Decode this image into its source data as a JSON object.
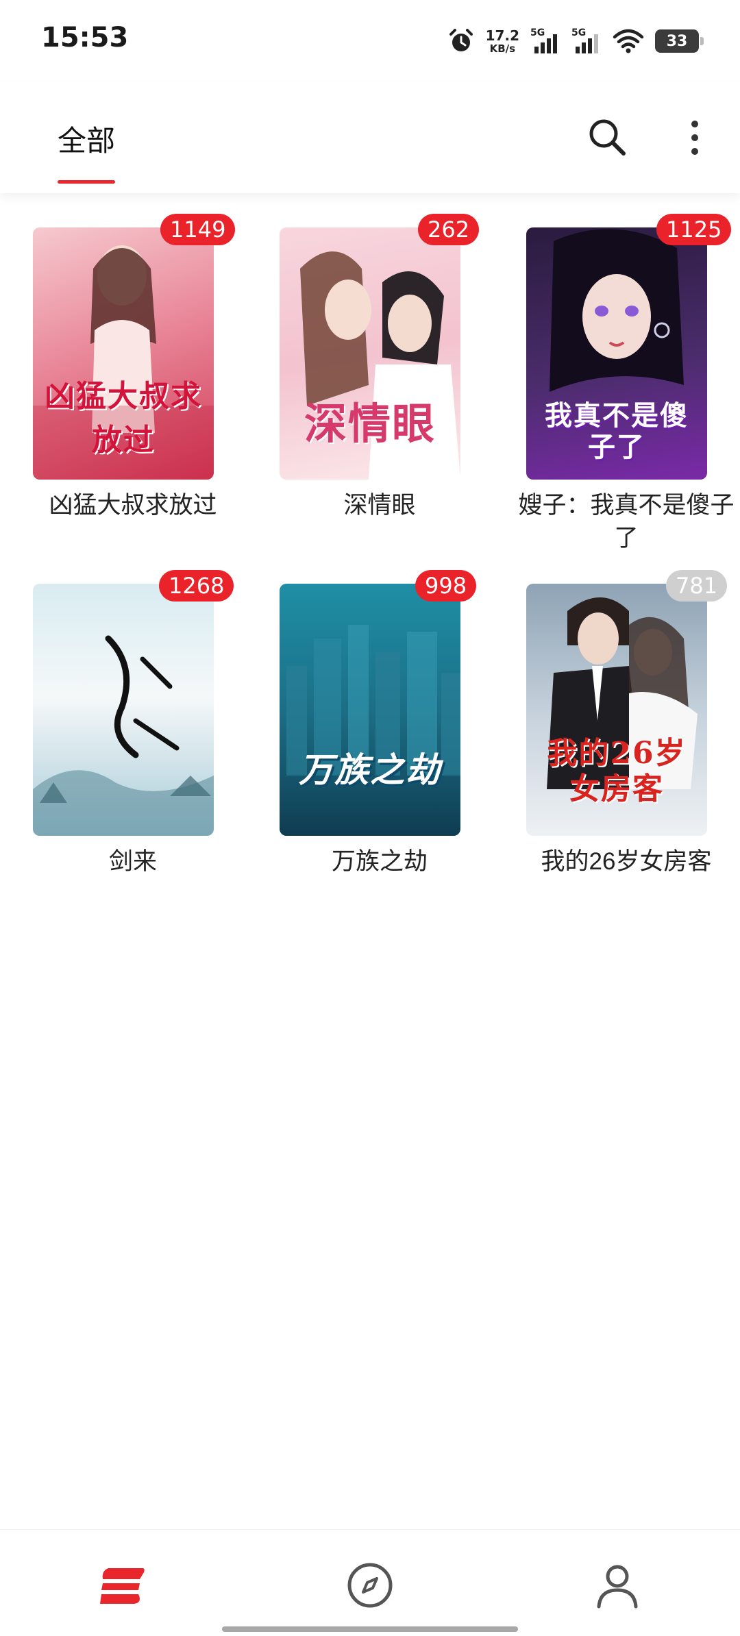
{
  "status_bar": {
    "time": "15:53",
    "net_speed_value": "17.2",
    "net_speed_unit": "KB/s",
    "sim1_tag": "5G",
    "sim2_tag": "5G",
    "battery": "33"
  },
  "header": {
    "tab_label": "全部",
    "search_icon": "search-icon",
    "more_icon": "more-vertical-icon"
  },
  "books": [
    {
      "title": "凶猛大叔求放过",
      "cover_text": "凶猛大叔求放过",
      "badge": "1149",
      "badge_color": "#ea2229"
    },
    {
      "title": "深情眼",
      "cover_text": "深情眼",
      "badge": "262",
      "badge_color": "#ea2229"
    },
    {
      "title": "嫂子：我真不是傻子了",
      "cover_text": "我真不是傻子了",
      "badge": "1125",
      "badge_color": "#ea2229"
    },
    {
      "title": "剑来",
      "cover_text": "剑来",
      "badge": "1268",
      "badge_color": "#ea2229"
    },
    {
      "title": "万族之劫",
      "cover_text": "万族之劫",
      "badge": "998",
      "badge_color": "#ea2229"
    },
    {
      "title": "我的26岁女房客",
      "cover_text": "我的26岁女房客",
      "badge": "781",
      "badge_color": "#cfcfcf"
    }
  ],
  "bottom_nav": {
    "bookshelf_icon": "bookshelf-icon",
    "discover_icon": "compass-icon",
    "profile_icon": "user-icon"
  },
  "colors": {
    "accent": "#e8262b",
    "badge_gray": "#cfcfcf"
  }
}
